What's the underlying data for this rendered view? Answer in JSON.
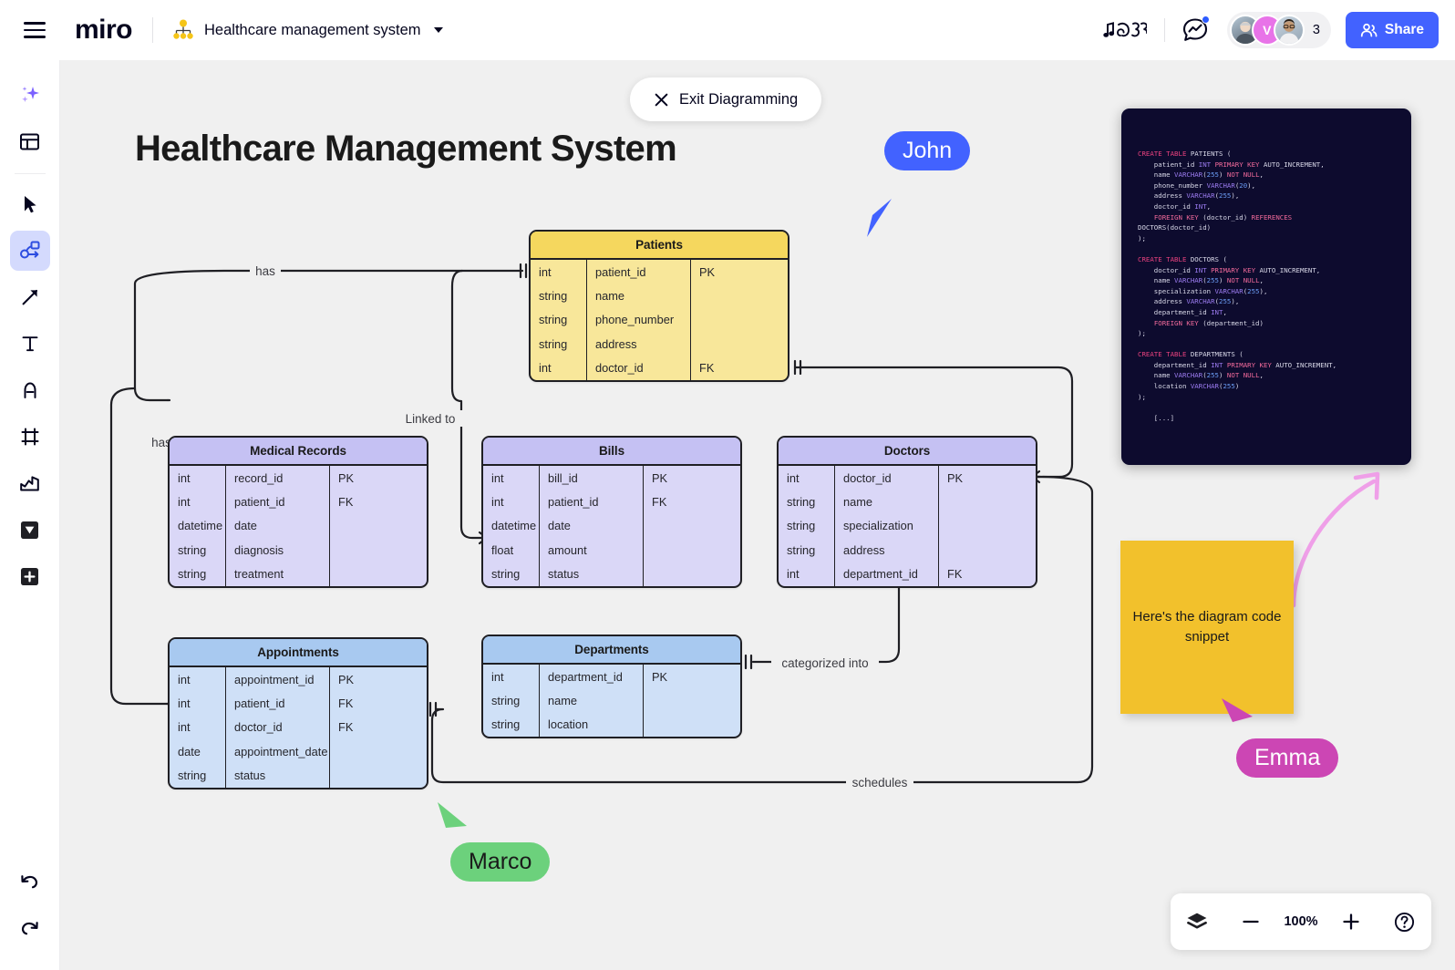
{
  "app": {
    "logo": "miro",
    "board_title": "Healthcare management system",
    "menu_icon": "hamburger-menu-icon",
    "board_type_icon": "diagram-node-icon"
  },
  "topbar": {
    "music_icon": "music-notes-icon",
    "chat_icon": "chat-bubble-icon",
    "collaborator_count": "3",
    "avatar_initial": "V",
    "share_label": "Share",
    "share_icon": "people-icon",
    "share_color": "#4262ff"
  },
  "toolbar": {
    "items": [
      {
        "name": "ai-sparkle-icon",
        "label": "AI"
      },
      {
        "name": "templates-icon",
        "label": "Templates"
      },
      {
        "name": "select-cursor-icon",
        "label": "Select"
      },
      {
        "name": "diagramming-icon",
        "label": "Diagramming",
        "active": true
      },
      {
        "name": "arrow-connector-icon",
        "label": "Connection line"
      },
      {
        "name": "text-icon",
        "label": "Text"
      },
      {
        "name": "pen-icon",
        "label": "Pen"
      },
      {
        "name": "frame-icon",
        "label": "Frame"
      },
      {
        "name": "upload-icon",
        "label": "Upload"
      },
      {
        "name": "apps-icon",
        "label": "Apps"
      },
      {
        "name": "more-plus-icon",
        "label": "More"
      }
    ],
    "undo_icon": "undo-icon",
    "redo_icon": "redo-icon"
  },
  "canvas": {
    "exit_button": {
      "label": "Exit Diagramming",
      "icon": "close-x-icon"
    },
    "heading": "Healthcare Management System",
    "background": "#f0f0f0"
  },
  "sticky_note": {
    "text": "Here's the diagram code snippet",
    "color": "#f2c12c"
  },
  "cursors": [
    {
      "name": "John",
      "color": "#4262ff"
    },
    {
      "name": "Marco",
      "color": "#6cd17c"
    },
    {
      "name": "Emma",
      "color": "#cc46b4"
    }
  ],
  "zoom_controls": {
    "layers_icon": "layers-icon",
    "minus_icon": "minus-icon",
    "zoom_level": "100%",
    "plus_icon": "plus-icon",
    "help_icon": "help-question-icon"
  },
  "chart_data": {
    "type": "diagram",
    "title": "Healthcare Management System",
    "notation": "entity-relationship (crow's foot)",
    "columns": [
      "type",
      "name",
      "key"
    ],
    "entities": [
      {
        "id": "patients",
        "title": "Patients",
        "color": "#f8e79a",
        "header_color": "#f5d75e",
        "fields": [
          {
            "type": "int",
            "name": "patient_id",
            "key": "PK"
          },
          {
            "type": "string",
            "name": "name",
            "key": ""
          },
          {
            "type": "string",
            "name": "phone_number",
            "key": ""
          },
          {
            "type": "string",
            "name": "address",
            "key": ""
          },
          {
            "type": "int",
            "name": "doctor_id",
            "key": "FK"
          }
        ]
      },
      {
        "id": "medical_records",
        "title": "Medical Records",
        "color": "#dad7f7",
        "header_color": "#c5c1f3",
        "fields": [
          {
            "type": "int",
            "name": "record_id",
            "key": "PK"
          },
          {
            "type": "int",
            "name": "patient_id",
            "key": "FK"
          },
          {
            "type": "datetime",
            "name": "date",
            "key": ""
          },
          {
            "type": "string",
            "name": "diagnosis",
            "key": ""
          },
          {
            "type": "string",
            "name": "treatment",
            "key": ""
          }
        ]
      },
      {
        "id": "bills",
        "title": "Bills",
        "color": "#dad7f7",
        "header_color": "#c5c1f3",
        "fields": [
          {
            "type": "int",
            "name": "bill_id",
            "key": "PK"
          },
          {
            "type": "int",
            "name": "patient_id",
            "key": "FK"
          },
          {
            "type": "datetime",
            "name": "date",
            "key": ""
          },
          {
            "type": "float",
            "name": "amount",
            "key": ""
          },
          {
            "type": "string",
            "name": "status",
            "key": ""
          }
        ]
      },
      {
        "id": "doctors",
        "title": "Doctors",
        "color": "#dad7f7",
        "header_color": "#c5c1f3",
        "fields": [
          {
            "type": "int",
            "name": "doctor_id",
            "key": "PK"
          },
          {
            "type": "string",
            "name": "name",
            "key": ""
          },
          {
            "type": "string",
            "name": "specialization",
            "key": ""
          },
          {
            "type": "string",
            "name": "address",
            "key": ""
          },
          {
            "type": "int",
            "name": "department_id",
            "key": "FK"
          }
        ]
      },
      {
        "id": "appointments",
        "title": "Appointments",
        "color": "#cfe0f7",
        "header_color": "#a8c9f0",
        "fields": [
          {
            "type": "int",
            "name": "appointment_id",
            "key": "PK"
          },
          {
            "type": "int",
            "name": "patient_id",
            "key": "FK"
          },
          {
            "type": "int",
            "name": "doctor_id",
            "key": "FK"
          },
          {
            "type": "date",
            "name": "appointment_date",
            "key": ""
          },
          {
            "type": "string",
            "name": "status",
            "key": ""
          }
        ]
      },
      {
        "id": "departments",
        "title": "Departments",
        "color": "#cfe0f7",
        "header_color": "#a8c9f0",
        "fields": [
          {
            "type": "int",
            "name": "department_id",
            "key": "PK"
          },
          {
            "type": "string",
            "name": "name",
            "key": ""
          },
          {
            "type": "string",
            "name": "location",
            "key": ""
          }
        ]
      }
    ],
    "relationships": [
      {
        "from": "patients",
        "to": "medical_records",
        "label": "has"
      },
      {
        "from": "patients",
        "to": "appointments",
        "label": "has"
      },
      {
        "from": "patients",
        "to": "bills",
        "label": "Linked to"
      },
      {
        "from": "doctors",
        "to": "departments",
        "label": "categorized into"
      },
      {
        "from": "doctors",
        "to": "appointments",
        "label": "schedules"
      },
      {
        "from": "patients",
        "to": "doctors",
        "label": ""
      }
    ]
  },
  "code_snippet": {
    "language": "sql",
    "lines": [
      [
        [
          "CREATE",
          "k-create"
        ],
        [
          " ",
          "k-plain"
        ],
        [
          "TABLE",
          "k-create"
        ],
        [
          " PATIENTS (",
          "k-plain"
        ]
      ],
      [
        [
          "    patient_id ",
          "k-plain"
        ],
        [
          "INT",
          "k-type"
        ],
        [
          " ",
          "k-plain"
        ],
        [
          "PRIMARY KEY",
          "k-key"
        ],
        [
          " AUTO_INCREMENT,",
          "k-plain"
        ]
      ],
      [
        [
          "    name ",
          "k-plain"
        ],
        [
          "VARCHAR",
          "k-type"
        ],
        [
          "(",
          "k-plain"
        ],
        [
          "255",
          "k-num"
        ],
        [
          ") ",
          "k-plain"
        ],
        [
          "NOT NULL",
          "k-key"
        ],
        [
          ",",
          "k-plain"
        ]
      ],
      [
        [
          "    phone_number ",
          "k-plain"
        ],
        [
          "VARCHAR",
          "k-type"
        ],
        [
          "(",
          "k-plain"
        ],
        [
          "20",
          "k-num"
        ],
        [
          "),",
          "k-plain"
        ]
      ],
      [
        [
          "    address ",
          "k-plain"
        ],
        [
          "VARCHAR",
          "k-type"
        ],
        [
          "(",
          "k-plain"
        ],
        [
          "255",
          "k-num"
        ],
        [
          "),",
          "k-plain"
        ]
      ],
      [
        [
          "    doctor_id ",
          "k-plain"
        ],
        [
          "INT",
          "k-type"
        ],
        [
          ",",
          "k-plain"
        ]
      ],
      [
        [
          "    ",
          "k-plain"
        ],
        [
          "FOREIGN KEY",
          "k-key"
        ],
        [
          " (doctor_id) ",
          "k-plain"
        ],
        [
          "REFERENCES",
          "k-key"
        ]
      ],
      [
        [
          "DOCTORS(doctor_id)",
          "k-plain"
        ]
      ],
      [
        [
          ");",
          "k-plain"
        ]
      ],
      [
        [
          "",
          "k-plain"
        ]
      ],
      [
        [
          "CREATE",
          "k-create"
        ],
        [
          " ",
          "k-plain"
        ],
        [
          "TABLE",
          "k-create"
        ],
        [
          " DOCTORS (",
          "k-plain"
        ]
      ],
      [
        [
          "    doctor_id ",
          "k-plain"
        ],
        [
          "INT",
          "k-type"
        ],
        [
          " ",
          "k-plain"
        ],
        [
          "PRIMARY KEY",
          "k-key"
        ],
        [
          " AUTO_INCREMENT,",
          "k-plain"
        ]
      ],
      [
        [
          "    name ",
          "k-plain"
        ],
        [
          "VARCHAR",
          "k-type"
        ],
        [
          "(",
          "k-plain"
        ],
        [
          "255",
          "k-num"
        ],
        [
          ") ",
          "k-plain"
        ],
        [
          "NOT NULL",
          "k-key"
        ],
        [
          ",",
          "k-plain"
        ]
      ],
      [
        [
          "    specialization ",
          "k-plain"
        ],
        [
          "VARCHAR",
          "k-type"
        ],
        [
          "(",
          "k-plain"
        ],
        [
          "255",
          "k-num"
        ],
        [
          "),",
          "k-plain"
        ]
      ],
      [
        [
          "    address ",
          "k-plain"
        ],
        [
          "VARCHAR",
          "k-type"
        ],
        [
          "(",
          "k-plain"
        ],
        [
          "255",
          "k-num"
        ],
        [
          "),",
          "k-plain"
        ]
      ],
      [
        [
          "    department_id ",
          "k-plain"
        ],
        [
          "INT",
          "k-type"
        ],
        [
          ",",
          "k-plain"
        ]
      ],
      [
        [
          "    ",
          "k-plain"
        ],
        [
          "FOREIGN KEY",
          "k-key"
        ],
        [
          " (department_id)",
          "k-plain"
        ]
      ],
      [
        [
          ");",
          "k-plain"
        ]
      ],
      [
        [
          "",
          "k-plain"
        ]
      ],
      [
        [
          "CREATE",
          "k-create"
        ],
        [
          " ",
          "k-plain"
        ],
        [
          "TABLE",
          "k-create"
        ],
        [
          " DEPARTMENTS (",
          "k-plain"
        ]
      ],
      [
        [
          "    department_id ",
          "k-plain"
        ],
        [
          "INT",
          "k-type"
        ],
        [
          " ",
          "k-plain"
        ],
        [
          "PRIMARY KEY",
          "k-key"
        ],
        [
          " AUTO_INCREMENT,",
          "k-plain"
        ]
      ],
      [
        [
          "    name ",
          "k-plain"
        ],
        [
          "VARCHAR",
          "k-type"
        ],
        [
          "(",
          "k-plain"
        ],
        [
          "255",
          "k-num"
        ],
        [
          ") ",
          "k-plain"
        ],
        [
          "NOT NULL",
          "k-key"
        ],
        [
          ",",
          "k-plain"
        ]
      ],
      [
        [
          "    location ",
          "k-plain"
        ],
        [
          "VARCHAR",
          "k-type"
        ],
        [
          "(",
          "k-plain"
        ],
        [
          "255",
          "k-num"
        ],
        [
          ")",
          "k-plain"
        ]
      ],
      [
        [
          ");",
          "k-plain"
        ]
      ],
      [
        [
          "",
          "k-plain"
        ]
      ],
      [
        [
          "    [...]",
          "k-plain"
        ]
      ]
    ]
  }
}
